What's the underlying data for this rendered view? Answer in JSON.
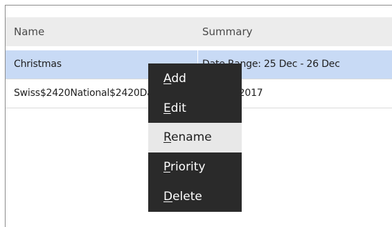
{
  "table": {
    "columns": [
      "Name",
      "Summary"
    ],
    "rows": [
      {
        "name": "Christmas",
        "summary": "Date Range: 25 Dec - 26 Dec",
        "selected": true
      },
      {
        "name": "Swiss$2420National$2420Day",
        "summary": "01 Aug 2017",
        "selected": false
      }
    ]
  },
  "context_menu": {
    "items": [
      {
        "mnemonic": "A",
        "rest": "dd",
        "highlighted": false
      },
      {
        "mnemonic": "E",
        "rest": "dit",
        "highlighted": false
      },
      {
        "mnemonic": "R",
        "rest": "ename",
        "highlighted": true
      },
      {
        "mnemonic": "P",
        "rest": "riority",
        "highlighted": false
      },
      {
        "mnemonic": "D",
        "rest": "elete",
        "highlighted": false
      }
    ]
  },
  "colors": {
    "selected_row": "#c8daf5",
    "menu_background": "#2a2a2a",
    "menu_highlight": "#e8e8e8",
    "header_background": "#ececec"
  }
}
